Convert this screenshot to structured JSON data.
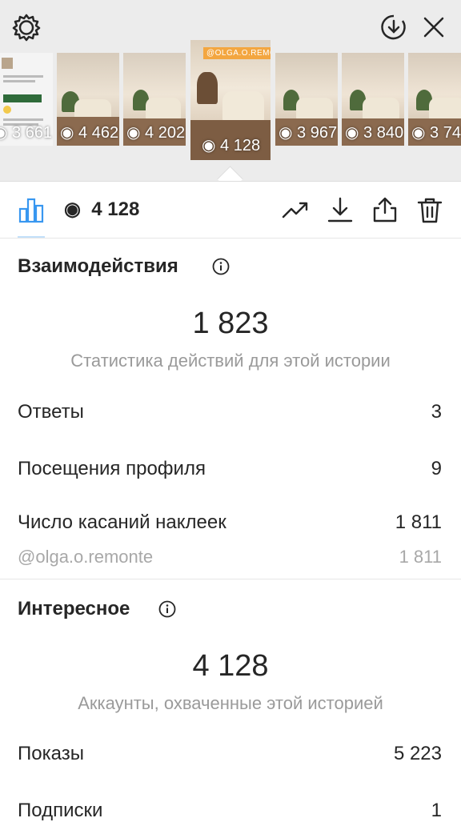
{
  "stories": [
    {
      "views": "3 661"
    },
    {
      "views": "4 462"
    },
    {
      "views": "4 202"
    },
    {
      "views": "3 967"
    },
    {
      "views": "3 840"
    },
    {
      "views": "3 74"
    }
  ],
  "selected_story": {
    "views": "4 128",
    "tag": "@OLGA.O.REMONTE"
  },
  "toolbar": {
    "reach": "4 128"
  },
  "interactions": {
    "title": "Взаимодействия",
    "total": "1 823",
    "subtitle": "Статистика действий для этой истории",
    "rows": [
      {
        "label": "Ответы",
        "value": "3"
      },
      {
        "label": "Посещения профиля",
        "value": "9"
      },
      {
        "label": "Число касаний наклеек",
        "value": "1 811"
      }
    ],
    "sticker_sub": {
      "label": "@olga.o.remonte",
      "value": "1 811"
    }
  },
  "discovery": {
    "title": "Интересное",
    "total": "4 128",
    "subtitle": "Аккаунты, охваченные этой историей",
    "rows": [
      {
        "label": "Показы",
        "value": "5 223"
      },
      {
        "label": "Подписки",
        "value": "1"
      }
    ]
  },
  "colors": {
    "accent": "#3897f0",
    "tag": "#f3a640"
  }
}
